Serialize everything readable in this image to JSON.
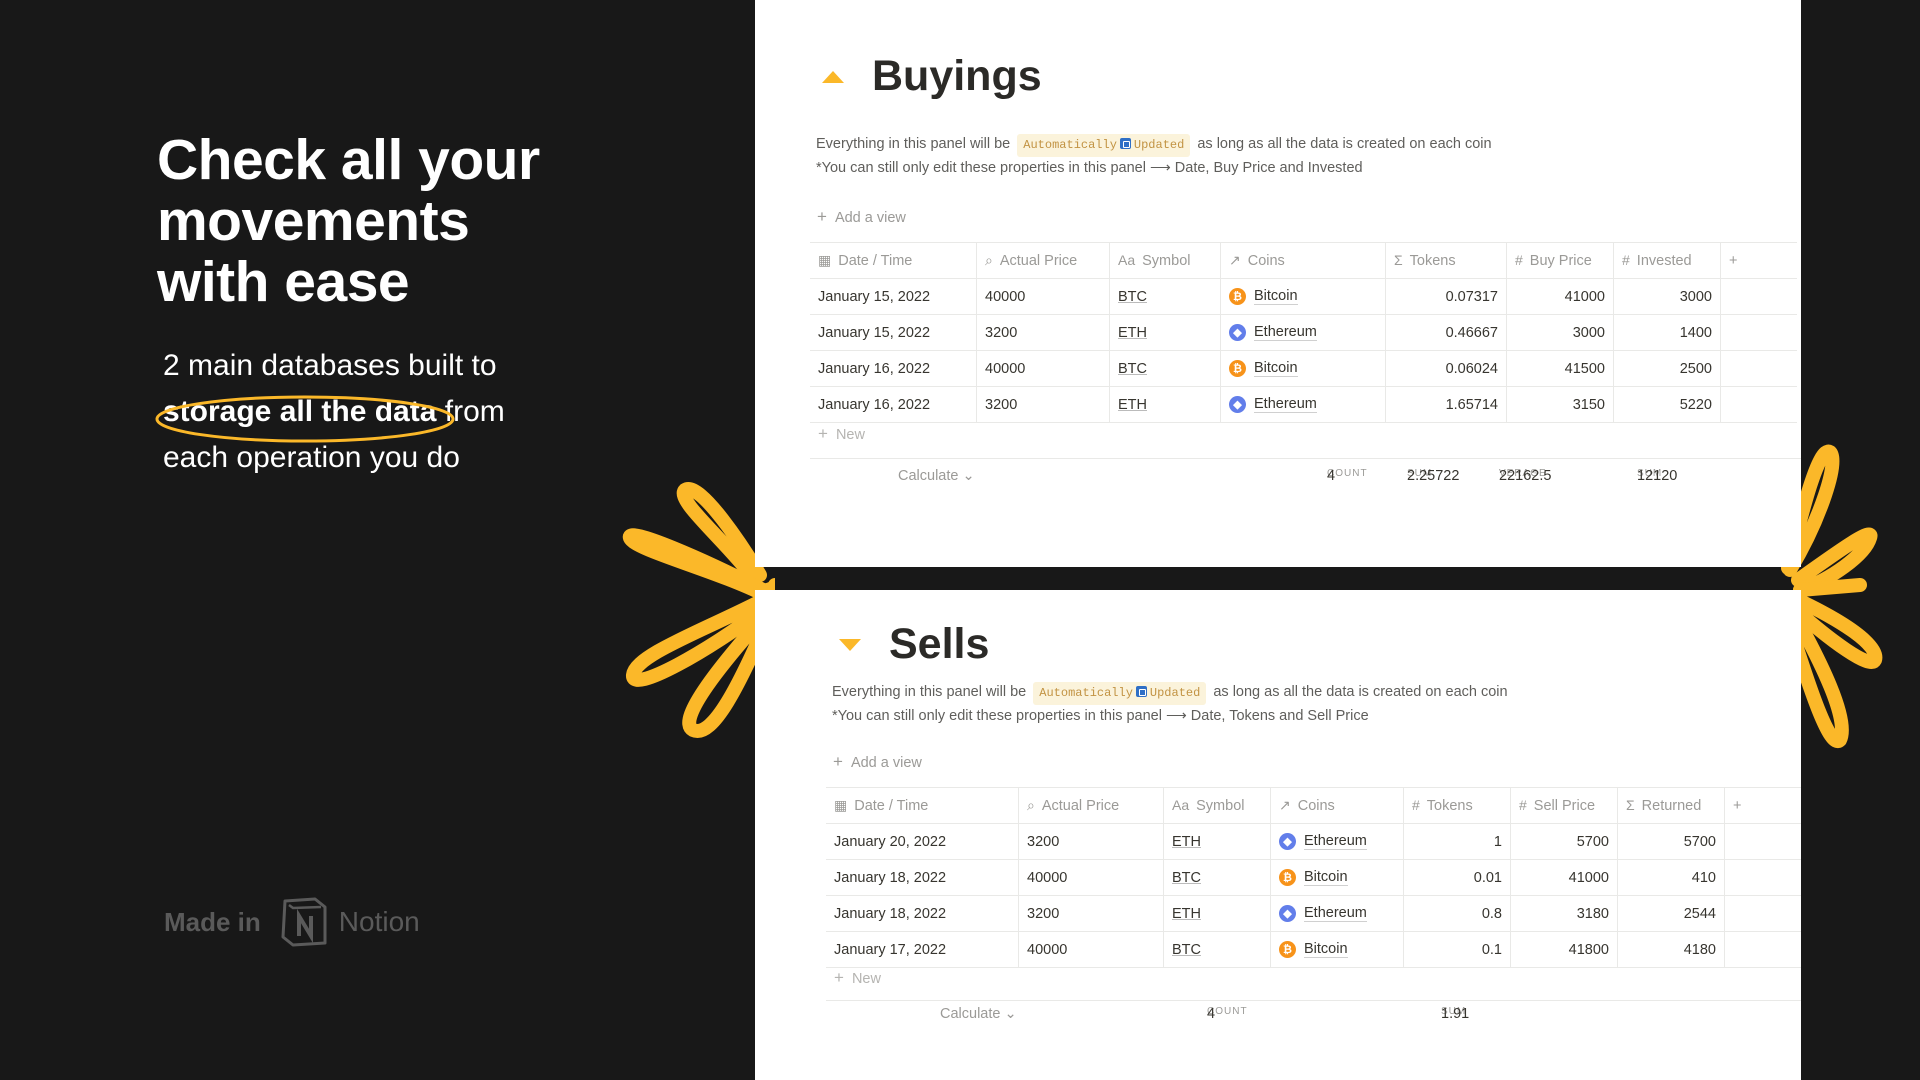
{
  "left": {
    "headline": [
      "Check all your",
      "movements",
      "with ease"
    ],
    "sub_line1": "2 main databases built to",
    "sub_highlight": "storage all the data",
    "sub_after_highlight": " from",
    "sub_line3": "each operation you do",
    "made_in": "Made in",
    "notion": "Notion"
  },
  "colors": {
    "accent": "#fbb829",
    "background": "#181818",
    "panel": "#ffffff"
  },
  "buyings": {
    "title": "Buyings",
    "desc_before": "Everything in this panel will be",
    "chip_a": "Automatically",
    "chip_b": "Updated",
    "desc_after": "as long as all the data is created on each coin",
    "desc_line2": "*You can still only edit these properties in this panel ⟶ Date, Buy Price and Invested",
    "add_view": "Add a view",
    "columns": [
      {
        "label": "Date / Time",
        "icon": "calendar-icon"
      },
      {
        "label": "Actual Price",
        "icon": "search-icon"
      },
      {
        "label": "Symbol",
        "icon": "text-icon"
      },
      {
        "label": "Coins",
        "icon": "relation-arrow-icon"
      },
      {
        "label": "Tokens",
        "icon": "sigma-icon"
      },
      {
        "label": "Buy Price",
        "icon": "hash-icon"
      },
      {
        "label": "Invested",
        "icon": "hash-icon"
      }
    ],
    "rows": [
      {
        "date": "January 15, 2022",
        "price": "40000",
        "symbol": "BTC",
        "coin": "Bitcoin",
        "coin_icon": "btc",
        "tokens": "0.07317",
        "buy": "41000",
        "invested": "3000"
      },
      {
        "date": "January 15, 2022",
        "price": "3200",
        "symbol": "ETH",
        "coin": "Ethereum",
        "coin_icon": "eth",
        "tokens": "0.46667",
        "buy": "3000",
        "invested": "1400"
      },
      {
        "date": "January 16, 2022",
        "price": "40000",
        "symbol": "BTC",
        "coin": "Bitcoin",
        "coin_icon": "btc",
        "tokens": "0.06024",
        "buy": "41500",
        "invested": "2500"
      },
      {
        "date": "January 16, 2022",
        "price": "3200",
        "symbol": "ETH",
        "coin": "Ethereum",
        "coin_icon": "eth",
        "tokens": "1.65714",
        "buy": "3150",
        "invested": "5220"
      }
    ],
    "new_label": "New",
    "calculate": "Calculate ⌄",
    "count_label": "COUNT",
    "count_value": "4",
    "sum_label": "SUM",
    "sum_tokens": "2.25722",
    "avg_label": "VERAGE",
    "avg_value": "22162.5",
    "sum_invested": "12120"
  },
  "sells": {
    "title": "Sells",
    "desc_before": "Everything in this panel will be",
    "chip_a": "Automatically",
    "chip_b": "Updated",
    "desc_after": "as long as all the data is created on each coin",
    "desc_line2": "*You can still only edit these properties in this panel ⟶ Date, Tokens and Sell Price",
    "add_view": "Add a view",
    "columns": [
      {
        "label": "Date / Time",
        "icon": "calendar-icon"
      },
      {
        "label": "Actual Price",
        "icon": "search-icon"
      },
      {
        "label": "Symbol",
        "icon": "text-icon"
      },
      {
        "label": "Coins",
        "icon": "relation-arrow-icon"
      },
      {
        "label": "Tokens",
        "icon": "hash-icon"
      },
      {
        "label": "Sell Price",
        "icon": "hash-icon"
      },
      {
        "label": "Returned",
        "icon": "sigma-icon"
      }
    ],
    "rows": [
      {
        "date": "January 20, 2022",
        "price": "3200",
        "symbol": "ETH",
        "coin": "Ethereum",
        "coin_icon": "eth",
        "tokens": "1",
        "sell": "5700",
        "returned": "5700"
      },
      {
        "date": "January 18, 2022",
        "price": "40000",
        "symbol": "BTC",
        "coin": "Bitcoin",
        "coin_icon": "btc",
        "tokens": "0.01",
        "sell": "41000",
        "returned": "410"
      },
      {
        "date": "January 18, 2022",
        "price": "3200",
        "symbol": "ETH",
        "coin": "Ethereum",
        "coin_icon": "eth",
        "tokens": "0.8",
        "sell": "3180",
        "returned": "2544"
      },
      {
        "date": "January 17, 2022",
        "price": "40000",
        "symbol": "BTC",
        "coin": "Bitcoin",
        "coin_icon": "btc",
        "tokens": "0.1",
        "sell": "41800",
        "returned": "4180"
      }
    ],
    "new_label": "New",
    "calculate": "Calculate ⌄",
    "count_label": "COUNT",
    "count_value": "4",
    "sum_label": "SUM",
    "sum_tokens": "1.91"
  }
}
